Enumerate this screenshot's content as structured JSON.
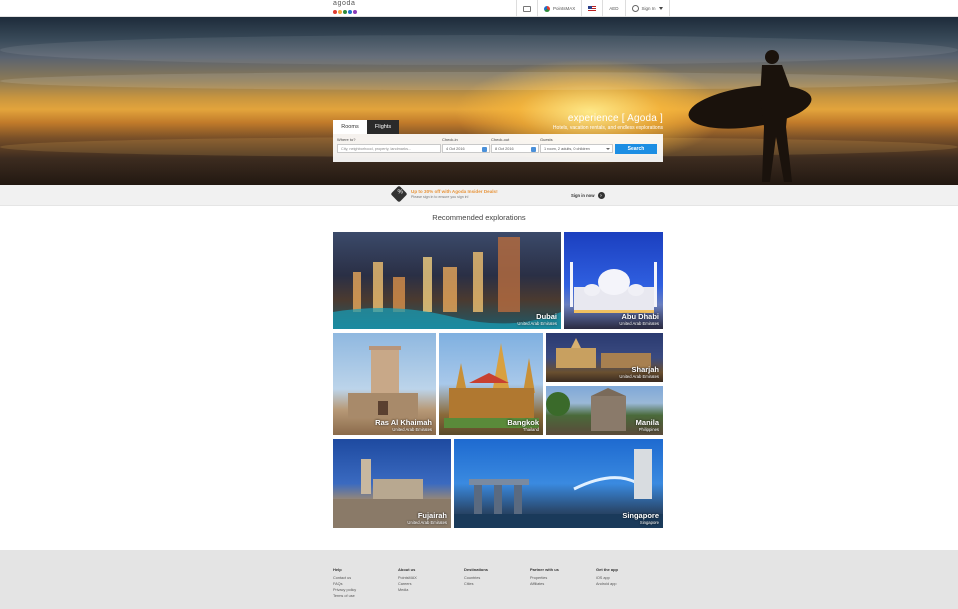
{
  "topbar": {
    "logo_text": "agoda",
    "logo_dot_colors": [
      "#e03c31",
      "#f4a93a",
      "#2e8b3a",
      "#1e6fc9",
      "#8a3ab9"
    ],
    "nav": {
      "pointsmax_label": "PointsMAX",
      "currency_label": "AED",
      "signin_label": "Sign In"
    }
  },
  "hero": {
    "tagline_title": "experience [ Agoda ]",
    "tagline_sub": "Hotels, vacation rentals, and endless explorations",
    "tabs": [
      "Rooms",
      "Flights"
    ],
    "fields": {
      "where_label": "Where to?",
      "where_placeholder": "City, neighborhood, property, landmarks...",
      "checkin_label": "Check-in",
      "checkin_value": "4 Oct 2016",
      "checkout_label": "Check-out",
      "checkout_value": "8 Oct 2016",
      "guests_label": "Guests",
      "guests_value": "1 room, 2 adults, 0 children"
    },
    "search_label": "Search"
  },
  "promo": {
    "title": "Up to 30% off with Agoda Insider Deals!",
    "subtitle": "Please sign in to ensure you sign in!",
    "signin_label": "Sign in now"
  },
  "recommended": {
    "title": "Recommended explorations",
    "tiles": [
      {
        "city": "Dubai",
        "country": "United Arab Emirates"
      },
      {
        "city": "Abu Dhabi",
        "country": "United Arab Emirates"
      },
      {
        "city": "Ras Al Khaimah",
        "country": "United Arab Emirates"
      },
      {
        "city": "Bangkok",
        "country": "Thailand"
      },
      {
        "city": "Sharjah",
        "country": "United Arab Emirates"
      },
      {
        "city": "Manila",
        "country": "Philippines"
      },
      {
        "city": "Fujairah",
        "country": "United Arab Emirates"
      },
      {
        "city": "Singapore",
        "country": "Singapore"
      }
    ]
  },
  "footer": {
    "columns": [
      {
        "heading": "Help",
        "links": [
          "Contact us",
          "FAQs",
          "Privacy policy",
          "Terms of use"
        ]
      },
      {
        "heading": "About us",
        "links": [
          "PointsMAX",
          "Careers",
          "Media"
        ]
      },
      {
        "heading": "Destinations",
        "links": [
          "Countries",
          "Cities"
        ]
      },
      {
        "heading": "Partner with us",
        "links": [
          "Properties",
          "Affiliates"
        ]
      },
      {
        "heading": "Get the app",
        "links": [
          "iOS app",
          "Android app"
        ]
      }
    ]
  }
}
